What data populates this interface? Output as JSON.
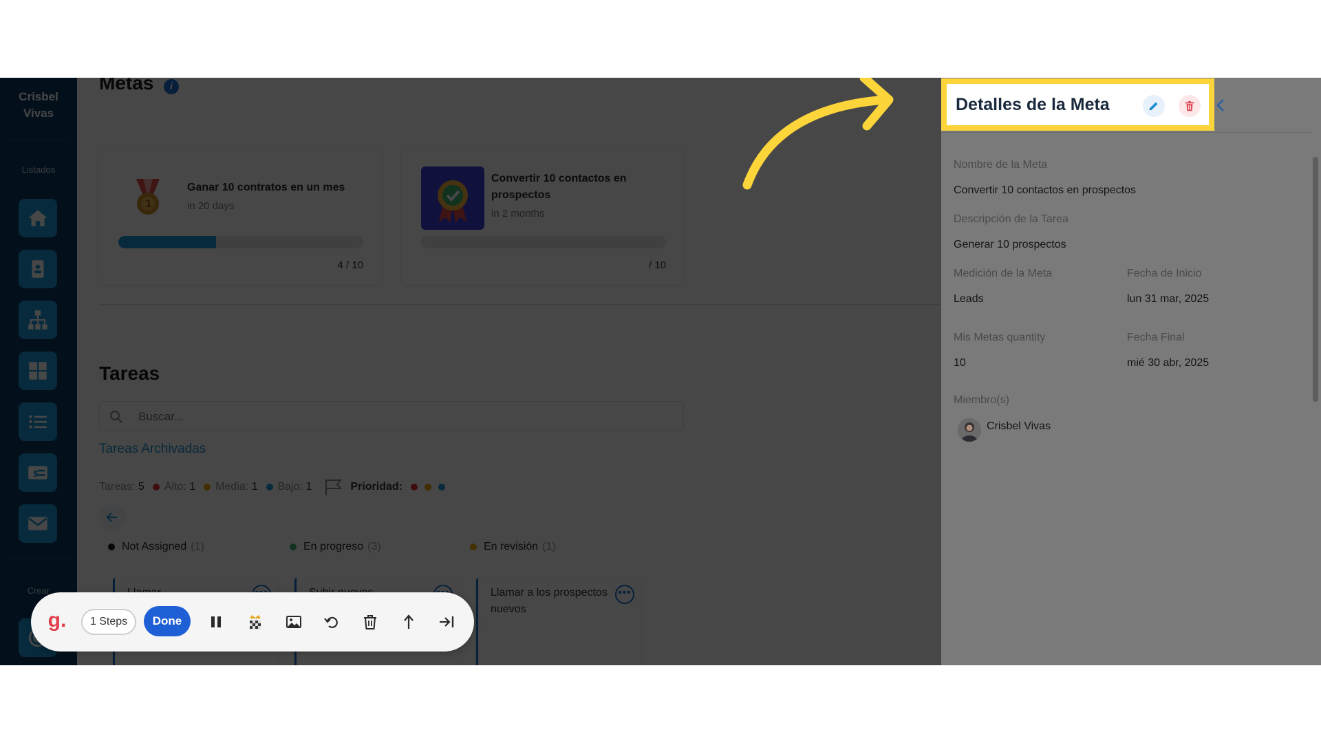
{
  "sidebar": {
    "user_name_line1": "Crisbel",
    "user_name_line2": "Vivas",
    "section_listados": "Listados",
    "section_crear": "Crear",
    "items": [
      {
        "name": "home"
      },
      {
        "name": "contacts"
      },
      {
        "name": "organization"
      },
      {
        "name": "dashboard"
      },
      {
        "name": "lists"
      },
      {
        "name": "billing"
      },
      {
        "name": "mail"
      }
    ]
  },
  "main": {
    "title": "Metas",
    "goals": [
      {
        "title": "Ganar 10 contratos en un mes",
        "subtitle": "in 20 days",
        "count": "4 / 10",
        "progress": 0.4
      },
      {
        "title": "Convertir 10 contactos en prospectos",
        "subtitle": "in 2 months",
        "count": "/ 10",
        "progress": 0
      }
    ],
    "tasks": {
      "title": "Tareas",
      "search_placeholder": "Buscar...",
      "archived_link": "Tareas Archivadas",
      "stats": {
        "tareas_label": "Tareas:",
        "tareas_count": "5",
        "alto_label": "Alto:",
        "alto_count": "1",
        "media_label": "Media:",
        "media_count": "1",
        "bajo_label": "Bajo:",
        "bajo_count": "1",
        "prioridad_label": "Prioridad:"
      },
      "columns": [
        {
          "label": "Not Assigned",
          "count": "(1)",
          "color": "#1a1a1a"
        },
        {
          "label": "En progreso",
          "count": "(3)",
          "color": "#3cb371"
        },
        {
          "label": "En revisión",
          "count": "(1)",
          "color": "#f0b400"
        }
      ],
      "cards": [
        {
          "title": "Llamar"
        },
        {
          "title": "Subir nuevos"
        },
        {
          "title": "Llamar a los prospectos nuevos"
        }
      ]
    }
  },
  "panel": {
    "title": "Detalles de la Meta",
    "fields": {
      "nombre_label": "Nombre de la Meta",
      "nombre_value": "Convertir 10 contactos en prospectos",
      "descripcion_label": "Descripción de la Tarea",
      "descripcion_value": "Generar 10 prospectos",
      "medicion_label": "Medición de la Meta",
      "medicion_value": "Leads",
      "fecha_inicio_label": "Fecha de Inicio",
      "fecha_inicio_value": "lun 31 mar, 2025",
      "quantity_label": "Mis Metas quantity",
      "quantity_value": "10",
      "fecha_final_label": "Fecha Final",
      "fecha_final_value": "mié 30 abr, 2025",
      "miembros_label": "Miembro(s)",
      "miembro_name": "Crisbel Vivas"
    }
  },
  "recorder": {
    "logo": "g.",
    "steps_label": "1 Steps",
    "done_label": "Done"
  },
  "colors": {
    "sidebar_bg": "#0d3a66",
    "accent": "#1b9bd7",
    "highlight": "#fcd53a",
    "priority_high": "#e03131",
    "priority_medium": "#f0a500",
    "priority_low": "#1b9bd7"
  }
}
